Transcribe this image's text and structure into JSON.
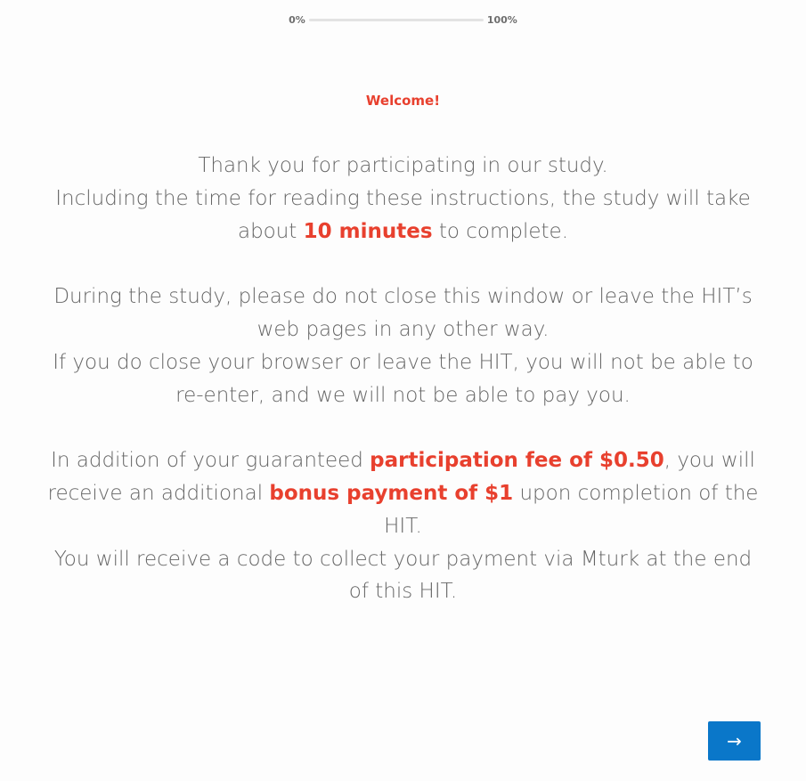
{
  "progress": {
    "start_label": "0%",
    "end_label": "100%",
    "value_percent": 0
  },
  "welcome": "Welcome!",
  "para1": {
    "line1": "Thank you for participating in our study.",
    "line2_before": "Including the time for reading these instructions, the study will take about ",
    "line2_highlight": "10 minutes",
    "line2_after": " to complete."
  },
  "para2": {
    "line1": "During the study, please do not close this window or leave the HIT’s web pages in any other way.",
    "line2": "If you do close your browser or leave the HIT, you will not be able to re-enter, and we will not be able to pay you."
  },
  "para3": {
    "before": "In addition of your guaranteed ",
    "highlight1": "participation fee of $0.50",
    "middle": ", you will receive an additional ",
    "highlight2": "bonus payment of $1",
    "after": " upon completion of the HIT.",
    "line2": "You will receive a code to collect your payment via Mturk at the end of this HIT."
  },
  "next_button": {
    "label": "→",
    "icon": "arrow-right-icon"
  },
  "colors": {
    "accent": "#e8402e",
    "button": "#0a77c9",
    "text": "#666666"
  }
}
